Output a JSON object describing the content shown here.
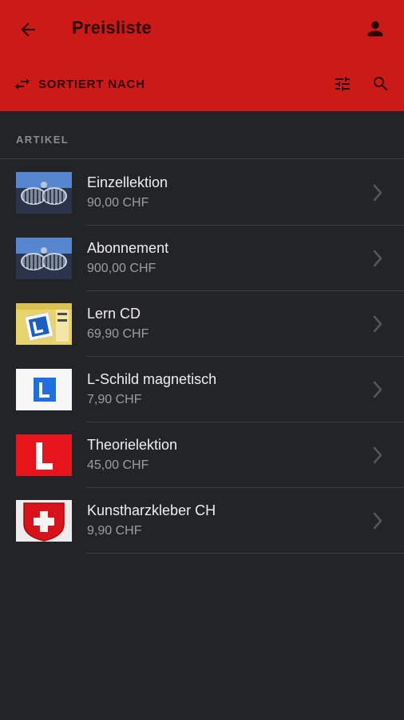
{
  "header": {
    "title": "Preisliste",
    "back_icon": "arrow-left-icon",
    "profile_icon": "person-icon"
  },
  "toolbar": {
    "sort_label": "SORTIERT NACH",
    "sort_icon": "swap-arrows-icon",
    "filter_icon": "sliders-icon",
    "search_icon": "search-icon"
  },
  "section": {
    "title": "ARTIKEL"
  },
  "items": [
    {
      "name": "Einzellektion",
      "price": "90,00 CHF",
      "thumb": "car-grille-image"
    },
    {
      "name": "Abonnement",
      "price": "900,00 CHF",
      "thumb": "car-grille-image"
    },
    {
      "name": "Lern CD",
      "price": "69,90 CHF",
      "thumb": "learning-cd-image"
    },
    {
      "name": "L-Schild magnetisch",
      "price": "7,90 CHF",
      "thumb": "l-sign-blue-image"
    },
    {
      "name": "Theorielektion",
      "price": "45,00 CHF",
      "thumb": "l-sign-red-image"
    },
    {
      "name": "Kunstharzkleber CH",
      "price": "9,90 CHF",
      "thumb": "swiss-sticker-image"
    }
  ],
  "colors": {
    "app_bar": "#cc1a17",
    "background": "#232427",
    "divider": "#3a3b3f"
  }
}
